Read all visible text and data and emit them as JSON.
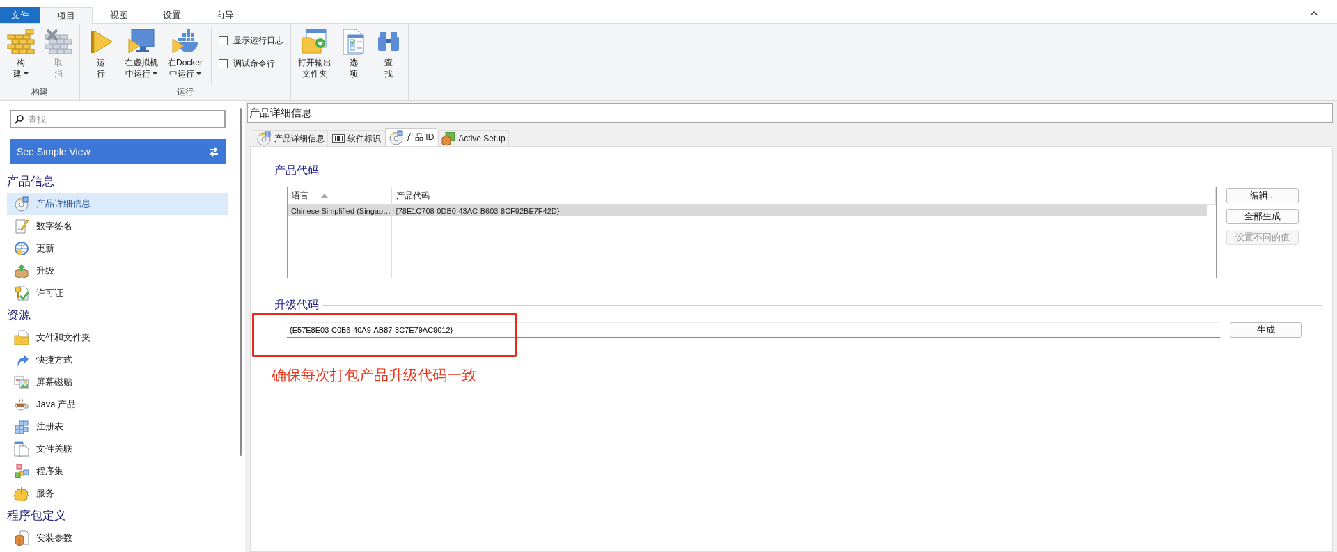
{
  "ribbon": {
    "tabs": [
      {
        "label": "文件",
        "kind": "file",
        "selected": false
      },
      {
        "label": "项目",
        "kind": "tab",
        "selected": true
      },
      {
        "label": "视图",
        "kind": "tab",
        "selected": false
      },
      {
        "label": "设置",
        "kind": "tab",
        "selected": false
      },
      {
        "label": "向导",
        "kind": "tab",
        "selected": false
      }
    ],
    "groups": [
      {
        "label": "构建",
        "items": [
          {
            "kind": "large",
            "lines": [
              "构",
              "建"
            ],
            "dropdown": true,
            "disabled": false
          },
          {
            "kind": "large",
            "lines": [
              "取",
              "消"
            ],
            "dropdown": false,
            "disabled": true
          }
        ]
      },
      {
        "label": "运行",
        "items": [
          {
            "kind": "large",
            "lines": [
              "运",
              "行"
            ],
            "dropdown": false,
            "disabled": false
          },
          {
            "kind": "large",
            "lines": [
              "在虚拟机",
              "中运行"
            ],
            "dropdown": true,
            "disabled": false
          },
          {
            "kind": "large",
            "lines": [
              "在Docker",
              "中运行"
            ],
            "dropdown": true,
            "disabled": false
          },
          {
            "kind": "check",
            "label": "显示运行日志",
            "checked": false
          },
          {
            "kind": "check",
            "label": "调试命令行",
            "checked": false
          }
        ]
      },
      {
        "items": [
          {
            "kind": "large",
            "lines": [
              "打开输出",
              "文件夹"
            ],
            "dropdown": false,
            "disabled": false
          },
          {
            "kind": "large",
            "lines": [
              "选",
              "项"
            ],
            "dropdown": false,
            "disabled": false
          },
          {
            "kind": "large",
            "lines": [
              "查",
              "找"
            ],
            "dropdown": false,
            "disabled": false
          }
        ]
      }
    ]
  },
  "sidebar": {
    "search": {
      "placeholder": "查找"
    },
    "view_button": {
      "label": "See Simple View"
    },
    "sections": [
      {
        "title": "产品信息",
        "items": [
          {
            "label": "产品详细信息",
            "selected": true
          },
          {
            "label": "数字签名",
            "selected": false
          },
          {
            "label": "更新",
            "selected": false
          },
          {
            "label": "升级",
            "selected": false
          },
          {
            "label": "许可证",
            "selected": false
          }
        ]
      },
      {
        "title": "资源",
        "items": [
          {
            "label": "文件和文件夹",
            "selected": false
          },
          {
            "label": "快捷方式",
            "selected": false
          },
          {
            "label": "屏幕磁贴",
            "selected": false
          },
          {
            "label": "Java 产品",
            "selected": false
          },
          {
            "label": "注册表",
            "selected": false
          },
          {
            "label": "文件关联",
            "selected": false
          },
          {
            "label": "程序集",
            "selected": false
          },
          {
            "label": "服务",
            "selected": false
          }
        ]
      },
      {
        "title": "程序包定义",
        "items": [
          {
            "label": "安装参数",
            "selected": false
          }
        ]
      }
    ]
  },
  "main": {
    "title": "产品详细信息",
    "tabs": [
      {
        "label": "产品详细信息",
        "selected": false
      },
      {
        "label": "软件标识",
        "selected": false
      },
      {
        "label": "产品 ID",
        "selected": true
      },
      {
        "label": "Active Setup",
        "selected": false
      }
    ],
    "product_code": {
      "title": "产品代码",
      "columns": [
        {
          "label": "语言",
          "sort_ascending": true
        },
        {
          "label": "产品代码"
        }
      ],
      "rows": [
        {
          "cells": [
            "Chinese Simplified (Singap…",
            "{78E1C708-0DB0-43AC-B603-8CF92BE7F42D}"
          ],
          "selected": true
        }
      ],
      "buttons": [
        {
          "label": "编辑...",
          "disabled": false
        },
        {
          "label": "全部生成",
          "disabled": false
        },
        {
          "label": "设置不同的值",
          "disabled": true
        }
      ]
    },
    "upgrade_code": {
      "title": "升级代码",
      "value": "{E57E8E03-C0B6-40A9-AB87-3C7E79AC9012}",
      "button": {
        "label": "生成",
        "disabled": false
      }
    },
    "annotation": {
      "text": "确保每次打包产品升级代码一致"
    }
  }
}
